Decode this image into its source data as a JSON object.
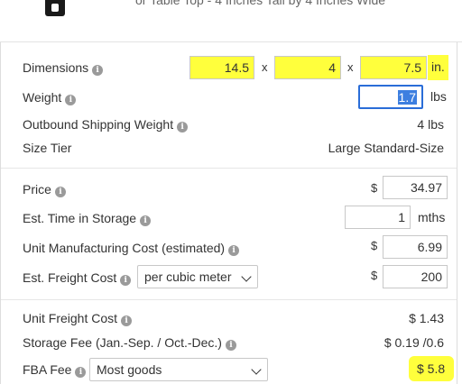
{
  "header": {
    "product_title": "or Table Top - 4 Inches Tall by 4 Inches Wide"
  },
  "dimensions": {
    "label": "Dimensions",
    "length": "14.5",
    "width": "4",
    "height": "7.5",
    "sep": "x",
    "unit": "in."
  },
  "weight": {
    "label": "Weight",
    "value": "1.7",
    "unit": "lbs"
  },
  "outbound": {
    "label": "Outbound Shipping Weight",
    "value": "4 lbs"
  },
  "size_tier": {
    "label": "Size Tier",
    "value": "Large Standard-Size"
  },
  "price": {
    "label": "Price",
    "currency": "$",
    "value": "34.97"
  },
  "storage_time": {
    "label": "Est. Time in Storage",
    "value": "1",
    "unit": "mths"
  },
  "mfg_cost": {
    "label": "Unit Manufacturing Cost (estimated)",
    "currency": "$",
    "value": "6.99"
  },
  "freight": {
    "label": "Est. Freight Cost",
    "option": "per cubic meter",
    "currency": "$",
    "value": "200"
  },
  "unit_freight": {
    "label": "Unit Freight Cost",
    "value": "$ 1.43"
  },
  "storage_fee": {
    "label": "Storage Fee (Jan.-Sep. / Oct.-Dec.)",
    "value": "$ 0.19 /0.6"
  },
  "fba_fee": {
    "label": "FBA Fee",
    "option": "Most goods",
    "value": "$ 5.8"
  },
  "info_glyph": "i",
  "colors": {
    "highlight": "#ffff3c",
    "focus": "#2a6dd8"
  }
}
